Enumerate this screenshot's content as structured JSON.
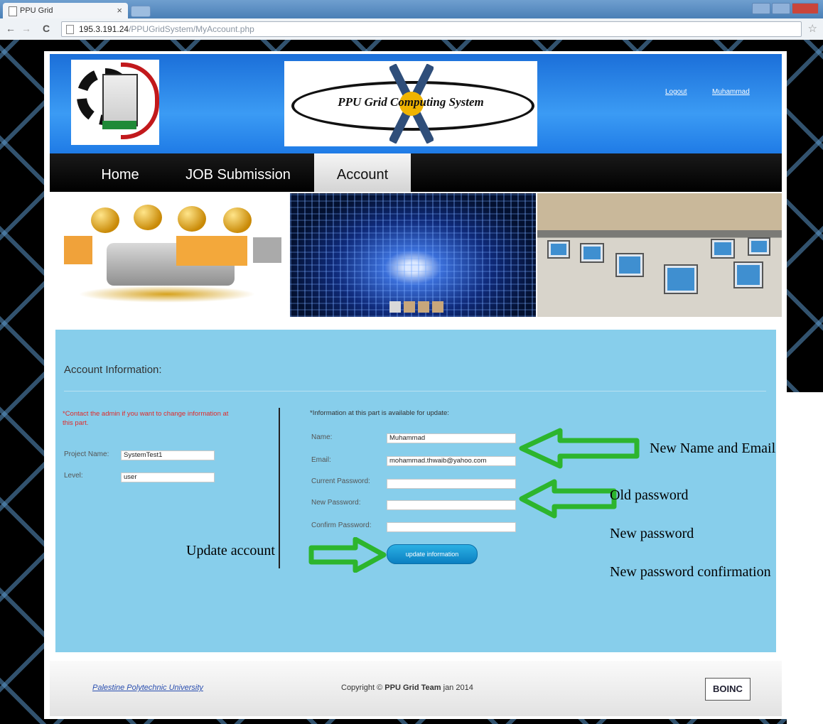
{
  "browser": {
    "tab_title": "PPU Grid",
    "tab_close": "×",
    "url_host": "195.3.191.24",
    "url_path": "/PPUGridSystem/MyAccount.php",
    "back": "←",
    "forward": "→",
    "reload": "C",
    "star": "☆"
  },
  "header": {
    "system_logo_text": "PPU Grid Computing System",
    "logout": "Logout",
    "username": "Muhammad"
  },
  "menu": {
    "items": [
      "Home",
      "JOB Submission",
      "Account"
    ],
    "active": "Account"
  },
  "account": {
    "title": "Account Information:",
    "admin_note": "*Contact the admin if you want to change information at this part.",
    "project_label": "Project Name:",
    "project_value": "SystemTest1",
    "level_label": "Level:",
    "level_value": "user",
    "update_note": "*Information at this part is available for update:",
    "name_label": "Name:",
    "name_value": "Muhammad",
    "email_label": "Email:",
    "email_value": "mohammad.thwaib@yahoo.com",
    "current_password_label": "Current Password:",
    "new_password_label": "New Password:",
    "confirm_password_label": "Confirm Password:",
    "update_button": "update information"
  },
  "footer": {
    "link": "Palestine Polytechnic University",
    "copyright_prefix": "Copyright © ",
    "copyright_team": "PPU Grid Team",
    "copyright_suffix": " jan 2014",
    "boinc": "BOINC"
  },
  "annotations": {
    "name_email": "New Name and Email",
    "old_password": "Old password",
    "new_password": "New password",
    "confirm_password": "New password confirmation",
    "update_account": "Update account"
  },
  "colors": {
    "content_bg": "#87ceeb",
    "arrow_green": "#2db52d",
    "header_blue": "#1b6fd9",
    "alert_red": "#e02a2a"
  }
}
